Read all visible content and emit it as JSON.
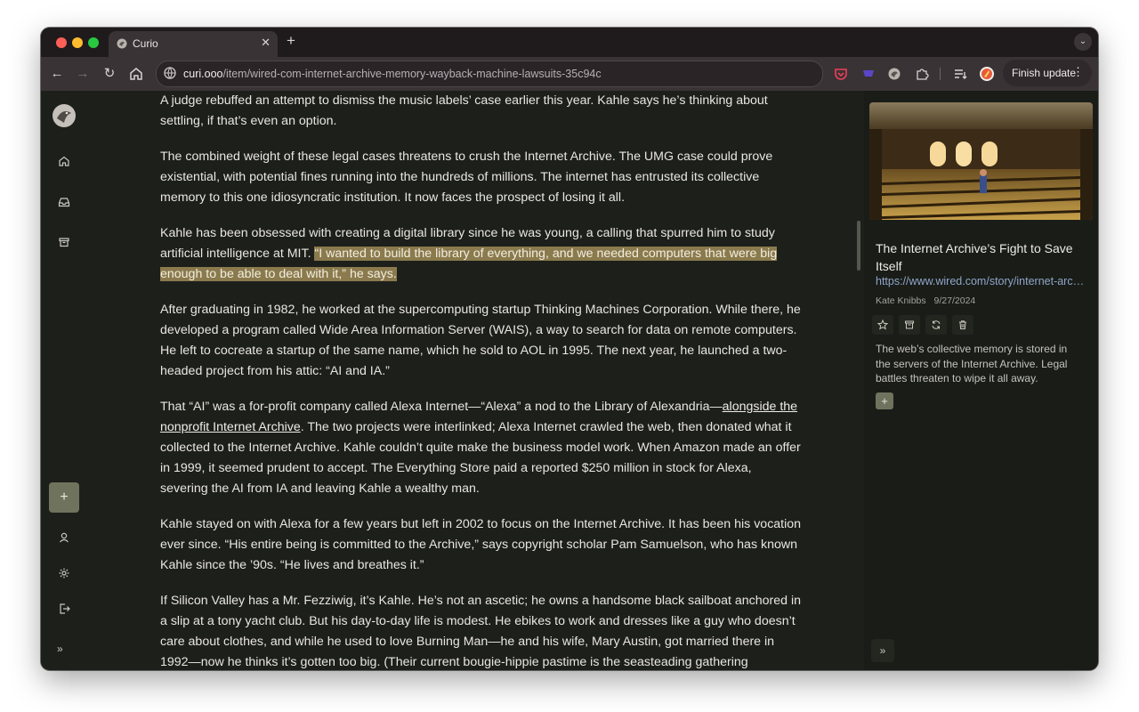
{
  "browser": {
    "tab_title": "Curio",
    "tab_close": "✕",
    "new_tab": "+",
    "url_host": "curi.ooo",
    "url_path": "/item/wired-com-internet-archive-memory-wayback-machine-lawsuits-35c94c",
    "finish_update_label": "Finish update",
    "menu_dots": "⋮"
  },
  "sidebar": {
    "add_label": "+",
    "expand_label": "»"
  },
  "article": {
    "p1": "A judge rebuffed an attempt to dismiss the music labels’ case earlier this year. Kahle says he’s thinking about settling, if that’s even an option.",
    "p2": "The combined weight of these legal cases threatens to crush the Internet Archive. The UMG case could prove existential, with potential fines running into the hundreds of millions. The internet has entrusted its collective memory to this one idiosyncratic institution. It now faces the prospect of losing it all.",
    "p3_a": "Kahle has been obsessed with creating a digital library since he was young, a calling that spurred him to study artificial intelligence at MIT. ",
    "p3_highlight": "“I wanted to build the library of everything, and we needed computers that were big enough to be able to deal with it,” he says.",
    "p4": "After graduating in 1982, he worked at the supercomputing startup Thinking Machines Corporation. While there, he developed a program called Wide Area Information Server (WAIS), a way to search for data on remote computers. He left to cocreate a startup of the same name, which he sold to AOL in 1995. The next year, he launched a two-headed project from his attic: “AI and IA.”",
    "p5_a": "That “AI” was a for-profit company called Alexa Internet—“Alexa” a nod to the Library of Alexandria—",
    "p5_link": "alongside the nonprofit Internet Archive",
    "p5_b": ". The two projects were interlinked; Alexa Internet crawled the web, then donated what it collected to the Internet Archive. Kahle couldn’t quite make the business model work. When Amazon made an offer in 1999, it seemed prudent to accept. The Everything Store paid a reported $250 million in stock for Alexa, severing the AI from IA and leaving Kahle a wealthy man.",
    "p6": "Kahle stayed on with Alexa for a few years but left in 2002 to focus on the Internet Archive. It has been his vocation ever since. “His entire being is committed to the Archive,” says copyright scholar Pam Samuelson, who has known Kahle since the ’90s. “He lives and breathes it.”",
    "p7": "If Silicon Valley has a Mr. Fezziwig, it’s Kahle. He’s not an ascetic; he owns a handsome black sailboat anchored in a slip at a tony yacht club. But his day-to-day life is modest. He ebikes to work and dresses like a guy who doesn’t care about clothes, and while he used to love Burning Man—he and his wife, Mary Austin, got married there in 1992—now he thinks it’s gotten too big. (Their current bougie-hippie pastime is the seasteading gathering Ephemerisle,"
  },
  "details": {
    "title": "The Internet Archive’s Fight to Save Itself",
    "url": "https://www.wired.com/story/internet-archive-memory-wayback-machine-lawsuits/",
    "author": "Kate Knibbs",
    "date": "9/27/2024",
    "description": "The web’s collective memory is stored in the servers of the Internet Archive. Legal battles threaten to wipe it all away.",
    "add_label": "+",
    "expand_label": "»"
  }
}
